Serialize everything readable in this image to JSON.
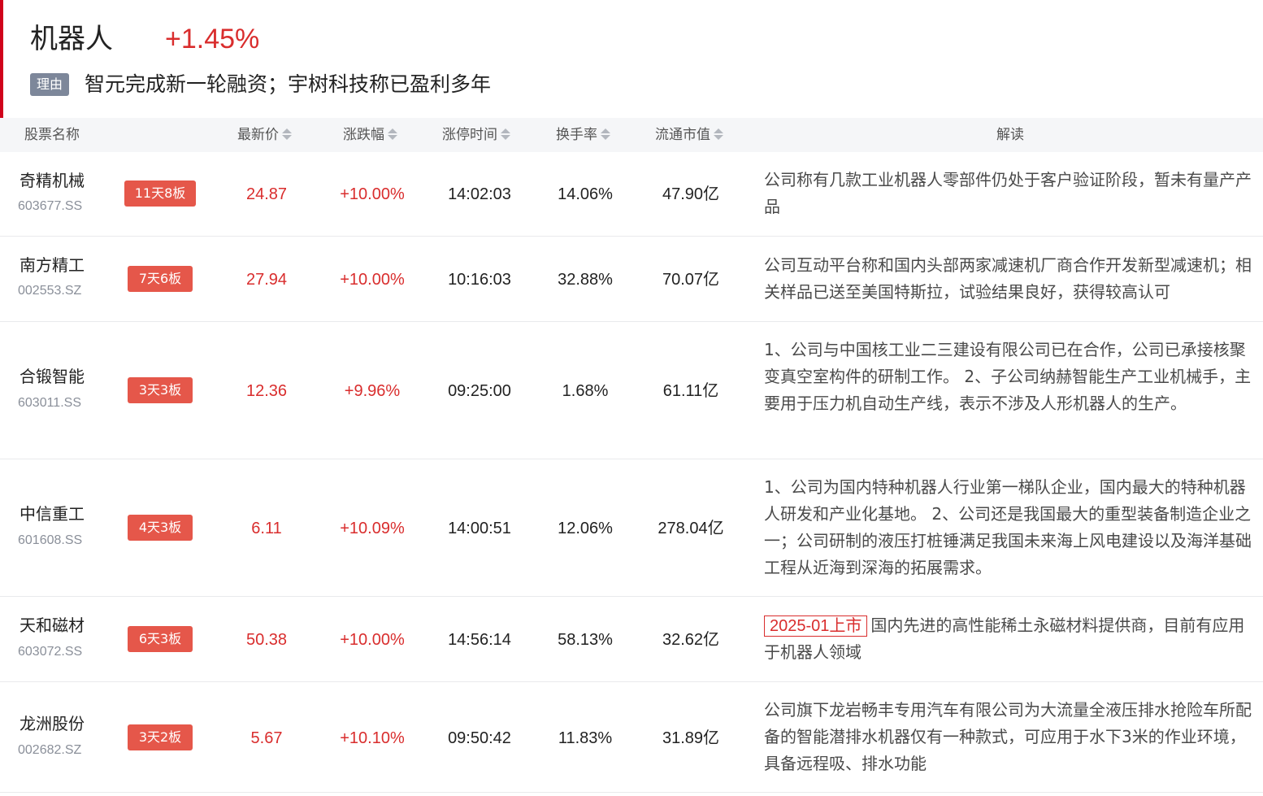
{
  "header": {
    "sector_name": "机器人",
    "sector_change": "+1.45%",
    "reason_tag": "理由",
    "reason_text": "智元完成新一轮融资；宇树科技称已盈利多年"
  },
  "table": {
    "columns": [
      "股票名称",
      "最新价",
      "涨跌幅",
      "涨停时间",
      "换手率",
      "流通市值",
      "解读"
    ],
    "rows": [
      {
        "name": "奇精机械",
        "code": "603677.SS",
        "badge": "11天8板",
        "price": "24.87",
        "change": "+10.00%",
        "limit_time": "14:02:03",
        "turnover": "14.06%",
        "market_cap": "47.90亿",
        "ipo_tag": "",
        "desc": "公司称有几款工业机器人零部件仍处于客户验证阶段，暂未有量产产品"
      },
      {
        "name": "南方精工",
        "code": "002553.SZ",
        "badge": "7天6板",
        "price": "27.94",
        "change": "+10.00%",
        "limit_time": "10:16:03",
        "turnover": "32.88%",
        "market_cap": "70.07亿",
        "ipo_tag": "",
        "desc": "公司互动平台称和国内头部两家减速机厂商合作开发新型减速机；相关样品已送至美国特斯拉，试验结果良好，获得较高认可"
      },
      {
        "name": "合锻智能",
        "code": "603011.SS",
        "badge": "3天3板",
        "price": "12.36",
        "change": "+9.96%",
        "limit_time": "09:25:00",
        "turnover": "1.68%",
        "market_cap": "61.11亿",
        "ipo_tag": "",
        "desc": "1、公司与中国核工业二三建设有限公司已在合作，公司已承接核聚变真空室构件的研制工作。 2、子公司纳赫智能生产工业机械手，主要用于压力机自动生产线，表示不涉及人形机器人的生产。"
      },
      {
        "name": "中信重工",
        "code": "601608.SS",
        "badge": "4天3板",
        "price": "6.11",
        "change": "+10.09%",
        "limit_time": "14:00:51",
        "turnover": "12.06%",
        "market_cap": "278.04亿",
        "ipo_tag": "",
        "desc": "1、公司为国内特种机器人行业第一梯队企业，国内最大的特种机器人研发和产业化基地。 2、公司还是我国最大的重型装备制造企业之一；公司研制的液压打桩锤满足我国未来海上风电建设以及海洋基础工程从近海到深海的拓展需求。"
      },
      {
        "name": "天和磁材",
        "code": "603072.SS",
        "badge": "6天3板",
        "price": "50.38",
        "change": "+10.00%",
        "limit_time": "14:56:14",
        "turnover": "58.13%",
        "market_cap": "32.62亿",
        "ipo_tag": "2025-01上市",
        "desc": "国内先进的高性能稀土永磁材料提供商，目前有应用于机器人领域"
      },
      {
        "name": "龙洲股份",
        "code": "002682.SZ",
        "badge": "3天2板",
        "price": "5.67",
        "change": "+10.10%",
        "limit_time": "09:50:42",
        "turnover": "11.83%",
        "market_cap": "31.89亿",
        "ipo_tag": "",
        "desc": "公司旗下龙岩畅丰专用汽车有限公司为大流量全液压排水抢险车所配备的智能潜排水机器仅有一种款式，可应用于水下3米的作业环境，具备远程吸、排水功能"
      }
    ]
  },
  "colors": {
    "accent": "#d0021b",
    "up": "#d92d2d",
    "badge": "#e5574a",
    "reason_tag_bg": "#7d879a",
    "header_bg": "#f5f6f8"
  },
  "icons": {
    "sort": "sort-up-down-icon"
  }
}
